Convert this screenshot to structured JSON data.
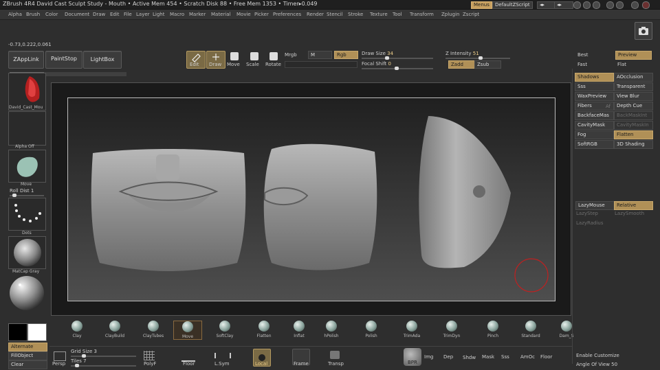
{
  "titlebar": {
    "title": "ZBrush 4R4    David Cast Sculpt Study - Mouth    • Active Mem 454 • Scratch Disk 88 • Free Mem 1353 • Timer▸0.049",
    "menus_btn": "Menus",
    "script_btn": "DefaultZScript"
  },
  "menus": [
    "Alpha",
    "Brush",
    "Color",
    "Document",
    "Draw",
    "Edit",
    "File",
    "Layer",
    "Light",
    "Macro",
    "Marker",
    "Material",
    "Movie",
    "Picker",
    "Preferences",
    "Render",
    "Stencil",
    "Stroke",
    "Texture",
    "Tool",
    "Transform",
    "Zplugin",
    "Zscript"
  ],
  "coords": "-0.73,0.222,0.061",
  "toolbar": {
    "zapplink": "ZAppLink",
    "paintstop": "PaintStop",
    "lightbox": "LightBox",
    "edit": "Edit",
    "draw": "Draw",
    "move": "Move",
    "scale": "Scale",
    "rotate": "Rotate",
    "mrgb": "Mrgb",
    "m": "M",
    "rgb": "Rgb",
    "draw_size_label": "Draw Size",
    "draw_size_value": "34",
    "focal_shift_label": "Focal Shift",
    "focal_shift_value": "0",
    "z_intensity_label": "Z Intensity",
    "z_intensity_value": "51",
    "zadd": "Zadd",
    "zsub": "Zsub"
  },
  "left_shelf": {
    "thumb1": "David_Cast_Mou",
    "thumb2": "Alpha Off",
    "thumb3": "Move",
    "roll_dist": "Roll Dist 1",
    "thumb4": "Dots",
    "thumb5": "MatCap Gray",
    "alternate": "Alternate",
    "fillobject": "FillObject",
    "clear": "Clear"
  },
  "right_panel": {
    "best": "Best",
    "preview": "Preview",
    "fast": "Fast",
    "flat": "Flat",
    "left_col": [
      "Shadows",
      "Sss",
      "WaxPreview",
      "Fibers",
      "BackfaceMas",
      "CavityMask",
      "Fog",
      "SoftRGB"
    ],
    "right_col": [
      "AOcclusion",
      "Transparent",
      "View Blur",
      "Depth Cue",
      "BackMaskInt",
      "CavityMaskIn",
      "Flatten",
      "3D Shading"
    ],
    "fibers_af": "Af",
    "lazymouse": "LazyMouse",
    "relative": "Relative",
    "lazystep": "LazyStep",
    "lazysmooth": "LazySmooth",
    "lazyradius": "LazyRadius"
  },
  "brushes": [
    "Clay",
    "ClayBuild",
    "ClayTubes",
    "Move",
    "SoftClay",
    "Flatten",
    "Inflat",
    "hPolish",
    "Polish",
    "TrimAda",
    "TrimDyn",
    "Pinch",
    "Standard",
    "Dam_S"
  ],
  "bottom": {
    "persp": "Persp",
    "grid_size": "Grid Size 3",
    "tiles": "Tiles 7",
    "polyf": "PolyF",
    "floor": "Floor",
    "lsym": "L.Sym",
    "local": "Local",
    "frame": "Frame",
    "transp": "Transp",
    "bpr": "BPR",
    "img": "Img",
    "dep": "Dep",
    "shdw": "Shdw",
    "mask": "Mask",
    "sss": "Sss",
    "amoc": "AmOc",
    "floor2": "Floor",
    "enable_customize": "Enable Customize",
    "angle_of_view": "Angle Of View 50"
  },
  "colors": {
    "accent": "#b09057",
    "background": "#2e2e2e",
    "canvas": "#333333"
  }
}
